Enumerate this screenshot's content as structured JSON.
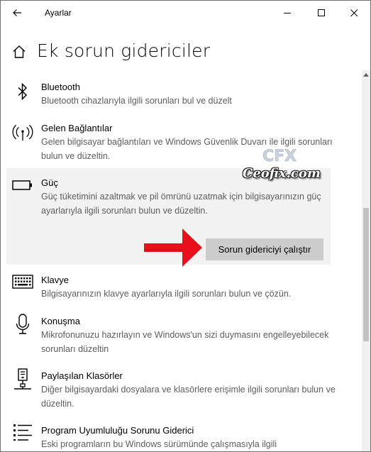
{
  "window": {
    "app_title": "Ayarlar"
  },
  "header": {
    "page_title": "Ek sorun gidericiler"
  },
  "items": [
    {
      "title": "Bluetooth",
      "desc": "Bluetooth cihazlarıyla ilgili sorunları bul ve düzelt",
      "icon": "bluetooth-icon"
    },
    {
      "title": "Gelen Bağlantılar",
      "desc": "Gelen bilgisayar bağlantıları ve Windows Güvenlik Duvarı ile ilgili sorunları bulun ve düzeltin.",
      "icon": "antenna-icon"
    },
    {
      "title": "Güç",
      "desc": "Güç tüketimini azaltmak ve pil ömrünü uzatmak için bilgisayarınızın güç ayarlarıyla ilgili sorunları bulun ve düzeltin.",
      "icon": "battery-icon",
      "selected": true,
      "button_label": "Sorun gidericiyi çalıştır"
    },
    {
      "title": "Klavye",
      "desc": "Bilgisayarınızın klavye ayarlarıyla ilgili sorunları bulun ve çözün.",
      "icon": "keyboard-icon"
    },
    {
      "title": "Konuşma",
      "desc": "Mikrofonunuzu hazırlayın ve Windows'un sizi duymasını engelleyebilecek sorunları düzeltin",
      "icon": "microphone-icon"
    },
    {
      "title": "Paylaşılan Klasörler",
      "desc": "Diğer bilgisayardaki dosyalara ve klasörlere erişimle ilgili sorunları bulun ve düzeltin.",
      "icon": "shared-folder-icon"
    },
    {
      "title": "Program Uyumluluğu Sorunu Giderici",
      "desc": "Eski programların bu Windows sürümünde çalışmasıyla ilgili",
      "icon": "program-list-icon"
    }
  ],
  "watermark": {
    "text": "Ceofix.com",
    "logo_text": "CFX"
  },
  "colors": {
    "selected_bg": "#f2f2f2",
    "button_bg": "#cccccc",
    "arrow": "#e8101a",
    "desc_text": "#5d5d5d"
  }
}
